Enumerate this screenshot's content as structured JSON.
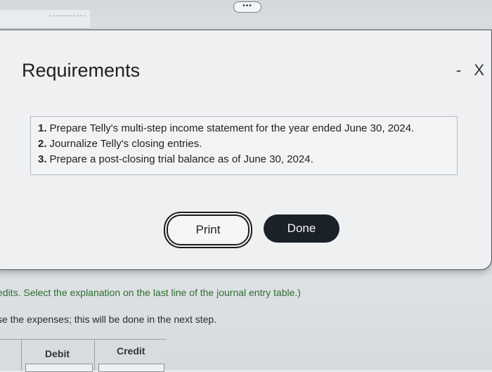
{
  "topbar": {
    "overflow_label": "•••"
  },
  "dialog": {
    "title": "Requirements",
    "minimize_label": "-",
    "close_label": "X",
    "requirements": [
      {
        "num": "1.",
        "text": "Prepare Telly's multi-step income statement for the year ended June 30, 2024."
      },
      {
        "num": "2.",
        "text": "Journalize Telly's closing entries."
      },
      {
        "num": "3.",
        "text": "Prepare a post-closing trial balance as of June 30, 2024."
      }
    ],
    "print_label": "Print",
    "done_label": "Done"
  },
  "background": {
    "instruction_1": "edits. Select the explanation on the last line of the journal entry table.)",
    "instruction_2": "se the expenses; this will be done in the next step.",
    "table": {
      "debit_header": "Debit",
      "credit_header": "Credit"
    }
  }
}
